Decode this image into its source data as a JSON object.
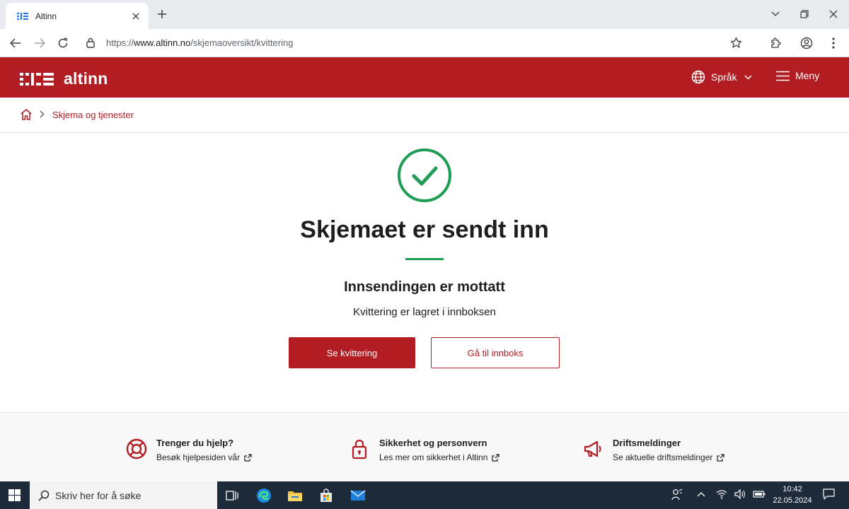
{
  "browser": {
    "tab_title": "Altinn",
    "url_prefix": "https://",
    "url_host": "www.altinn.no",
    "url_path": "/skjemaoversikt/kvittering"
  },
  "header": {
    "logo_text": "altinn",
    "language_label": "Språk",
    "menu_label": "Meny",
    "brand_color": "#b11d22"
  },
  "breadcrumb": {
    "items": [
      "Skjema og tjenester"
    ]
  },
  "main": {
    "title": "Skjemaet er sendt inn",
    "subtitle": "Innsendingen er mottatt",
    "note": "Kvittering er lagret i innboksen",
    "primary_button": "Se kvittering",
    "secondary_button": "Gå til innboks",
    "success_color": "#1f9d55"
  },
  "footer": {
    "items": [
      {
        "title": "Trenger du hjelp?",
        "link": "Besøk hjelpesiden vår",
        "icon": "lifebuoy-icon"
      },
      {
        "title": "Sikkerhet og personvern",
        "link": "Les mer om sikkerhet i Altinn",
        "icon": "padlock-icon"
      },
      {
        "title": "Driftsmeldinger",
        "link": "Se aktuelle driftsmeldinger",
        "icon": "megaphone-icon"
      }
    ]
  },
  "taskbar": {
    "search_placeholder": "Skriv her for å søke",
    "time": "10:42",
    "date": "22.05.2024"
  }
}
